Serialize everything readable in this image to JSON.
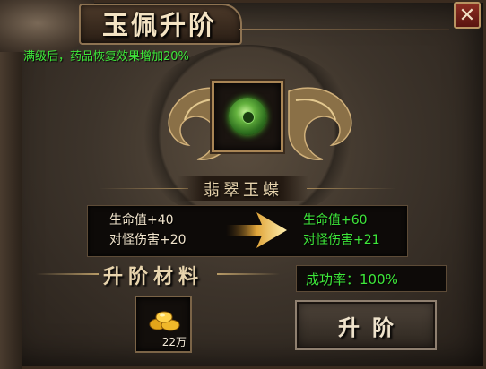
{
  "window": {
    "title": "玉佩升阶",
    "close_label": "✕"
  },
  "notice": "满级后，药品恢复效果增加20%",
  "item": {
    "name": "翡翠玉蝶",
    "icon": "jade-disc-icon"
  },
  "stats": {
    "current": [
      {
        "label": "生命值+40"
      },
      {
        "label": "对怪伤害+20"
      }
    ],
    "next": [
      {
        "label": "生命值+60"
      },
      {
        "label": "对怪伤害+21"
      }
    ]
  },
  "materials": {
    "title": "升阶材料",
    "slot": {
      "icon": "gold-pile-icon",
      "quantity": "22万"
    }
  },
  "success_rate": "成功率：100%",
  "upgrade_button": "升阶",
  "colors": {
    "green_text": "#3ee83a",
    "gold_frame": "#a98555",
    "close_red": "#8c2e22"
  }
}
